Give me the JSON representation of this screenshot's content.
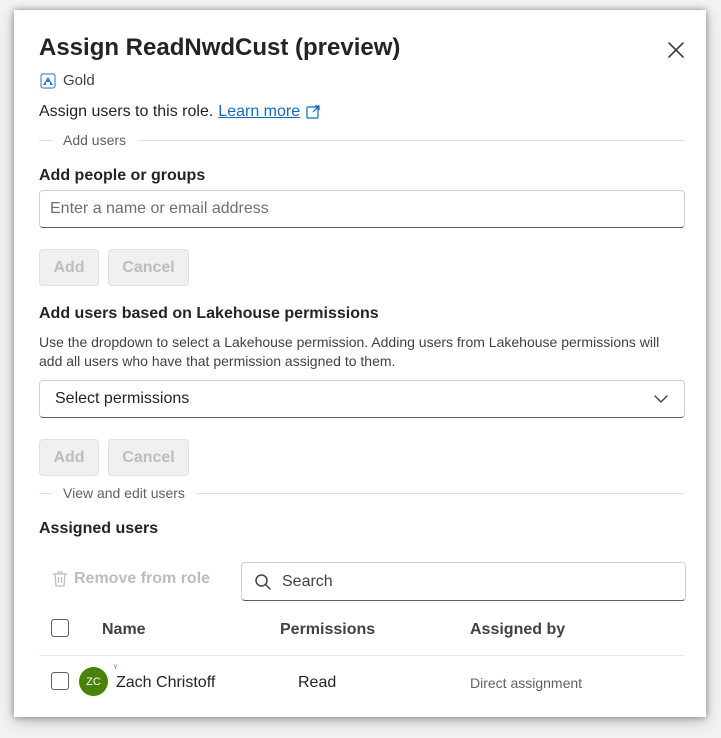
{
  "dialog": {
    "title": "Assign ReadNwdCust (preview)",
    "lakehouse_name": "Gold",
    "assign_text": "Assign users to this role.",
    "learn_more": "Learn more"
  },
  "add_users_section": {
    "divider_label": "Add users",
    "heading": "Add people or groups",
    "input_placeholder": "Enter a name or email address",
    "add_label": "Add",
    "cancel_label": "Cancel"
  },
  "lakehouse_section": {
    "heading": "Add users based on Lakehouse permissions",
    "description": "Use the dropdown to select a Lakehouse permission. Adding users from Lakehouse permissions will add all users who have that permission assigned to them.",
    "dropdown_value": "Select permissions",
    "add_label": "Add",
    "cancel_label": "Cancel"
  },
  "view_section": {
    "divider_label": "View and edit users",
    "heading": "Assigned users",
    "remove_label": "Remove from role",
    "search_placeholder": "Search",
    "columns": [
      "Name",
      "Permissions",
      "Assigned by"
    ],
    "rows": [
      {
        "initials": "ZC",
        "name": "Zach Christoff",
        "permission": "Read",
        "assigned_by": "Direct assignment"
      }
    ]
  },
  "colors": {
    "accent_link": "#0f6cbd",
    "avatar": "#498205",
    "disabled_text": "#bdbdbd"
  },
  "icons": {
    "close": "close-icon",
    "lakehouse": "lakehouse-icon",
    "external_link": "open-external-icon",
    "chevron": "chevron-down-icon",
    "trash": "trash-icon",
    "search": "search-icon"
  }
}
